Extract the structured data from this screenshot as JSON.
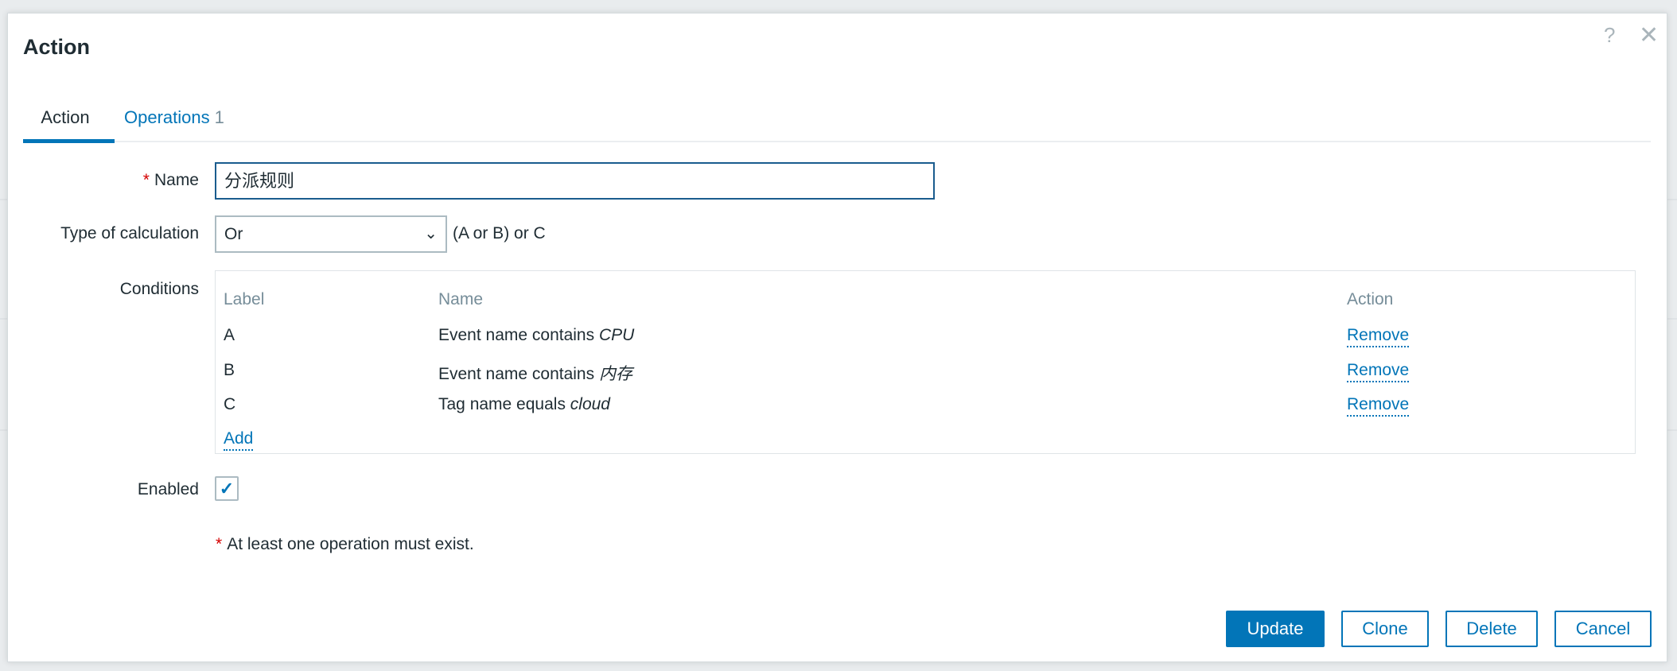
{
  "dialog": {
    "title": "Action",
    "help_icon": "question-icon",
    "close_icon": "close-icon"
  },
  "tabs": [
    {
      "label": "Action",
      "active": true
    },
    {
      "label": "Operations",
      "count": "1"
    }
  ],
  "form": {
    "name": {
      "label": "Name",
      "required_mark": "*",
      "value": "分派规则"
    },
    "calc": {
      "label": "Type of calculation",
      "value": "Or",
      "formula": "(A or B) or C"
    },
    "conditions": {
      "label": "Conditions",
      "headers": {
        "label": "Label",
        "name": "Name",
        "action": "Action"
      },
      "rows": [
        {
          "label": "A",
          "prefix": "Event name contains ",
          "value": "CPU",
          "action": "Remove"
        },
        {
          "label": "B",
          "prefix": "Event name contains ",
          "value": "内存",
          "action": "Remove"
        },
        {
          "label": "C",
          "prefix": "Tag name equals ",
          "value": "cloud",
          "action": "Remove"
        }
      ],
      "add_label": "Add"
    },
    "enabled": {
      "label": "Enabled",
      "checked": true
    },
    "note": {
      "mark": "*",
      "text": "At least one operation must exist."
    }
  },
  "buttons": {
    "update": "Update",
    "clone": "Clone",
    "delete": "Delete",
    "cancel": "Cancel"
  },
  "colors": {
    "accent": "#0275b8",
    "required": "#d40000"
  }
}
